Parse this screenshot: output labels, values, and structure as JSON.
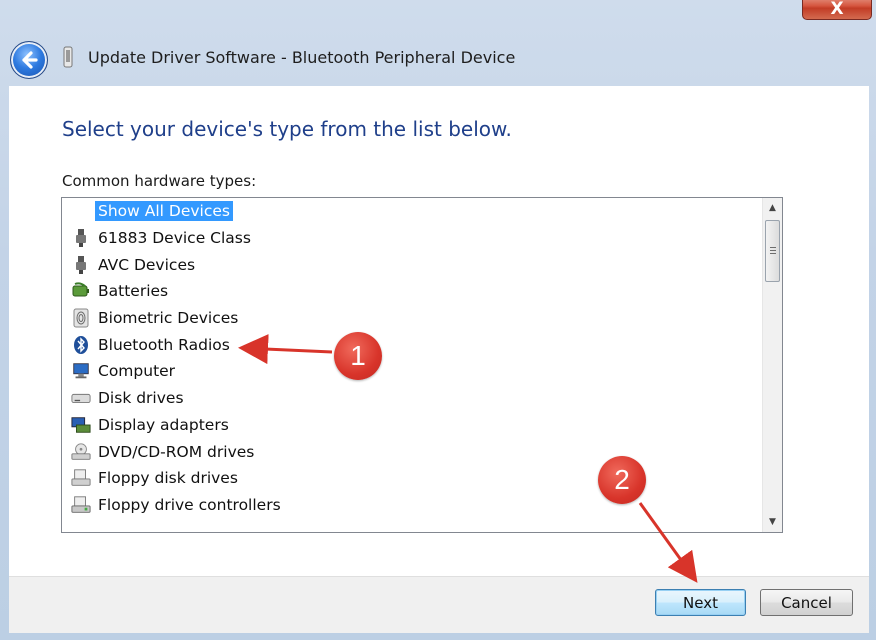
{
  "window": {
    "title": "Update Driver Software - Bluetooth Peripheral Device",
    "close_glyph": "X"
  },
  "main": {
    "heading": "Select your device's type from the list below.",
    "list_label": "Common hardware types:",
    "items": [
      {
        "label": "Show All Devices",
        "icon": "none",
        "selected": true
      },
      {
        "label": "61883 Device Class",
        "icon": "usb-plug-icon"
      },
      {
        "label": "AVC Devices",
        "icon": "usb-plug-icon"
      },
      {
        "label": "Batteries",
        "icon": "battery-icon"
      },
      {
        "label": "Biometric Devices",
        "icon": "fingerprint-icon"
      },
      {
        "label": "Bluetooth Radios",
        "icon": "bluetooth-icon"
      },
      {
        "label": "Computer",
        "icon": "computer-icon"
      },
      {
        "label": "Disk drives",
        "icon": "disk-drive-icon"
      },
      {
        "label": "Display adapters",
        "icon": "display-adapter-icon"
      },
      {
        "label": "DVD/CD-ROM drives",
        "icon": "dvd-drive-icon"
      },
      {
        "label": "Floppy disk drives",
        "icon": "floppy-drive-icon"
      },
      {
        "label": "Floppy drive controllers",
        "icon": "floppy-controller-icon"
      }
    ]
  },
  "footer": {
    "next_label": "Next",
    "cancel_label": "Cancel"
  },
  "annotations": [
    {
      "number": "1",
      "target": "Bluetooth Radios"
    },
    {
      "number": "2",
      "target": "Next"
    }
  ],
  "colors": {
    "heading": "#1f3f8a",
    "selection": "#3399ff",
    "badge": "#d8342a"
  }
}
